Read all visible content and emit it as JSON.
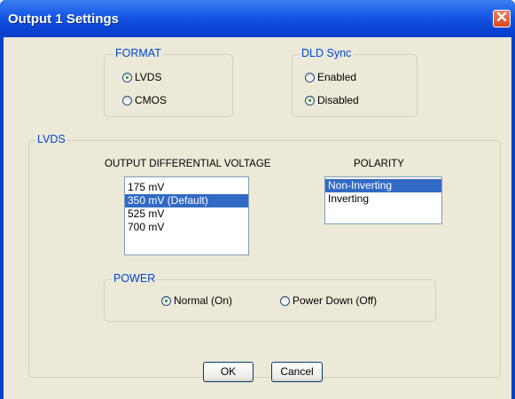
{
  "window": {
    "title": "Output 1 Settings",
    "close_glyph": "✕"
  },
  "format": {
    "legend": "FORMAT",
    "options": [
      "LVDS",
      "CMOS"
    ],
    "selected": "LVDS"
  },
  "dld_sync": {
    "legend": "DLD Sync",
    "options": [
      "Enabled",
      "Disabled"
    ],
    "selected": "Disabled"
  },
  "lvds": {
    "legend": "LVDS",
    "voltage": {
      "label": "OUTPUT DIFFERENTIAL VOLTAGE",
      "items": [
        "175 mV",
        "350 mV (Default)",
        "525 mV",
        "700 mV"
      ],
      "selected": "350 mV (Default)"
    },
    "polarity": {
      "label": "POLARITY",
      "items": [
        "Non-Inverting",
        "Inverting"
      ],
      "selected": "Non-Inverting"
    },
    "power": {
      "legend": "POWER",
      "options": [
        "Normal (On)",
        "Power Down (Off)"
      ],
      "selected": "Normal (On)"
    }
  },
  "buttons": {
    "ok": "OK",
    "cancel": "Cancel"
  },
  "colors": {
    "title_bar": "#0a3fc8",
    "group_legend": "#0046d5",
    "selection": "#316ac5",
    "dialog_bg": "#ece9d8"
  }
}
